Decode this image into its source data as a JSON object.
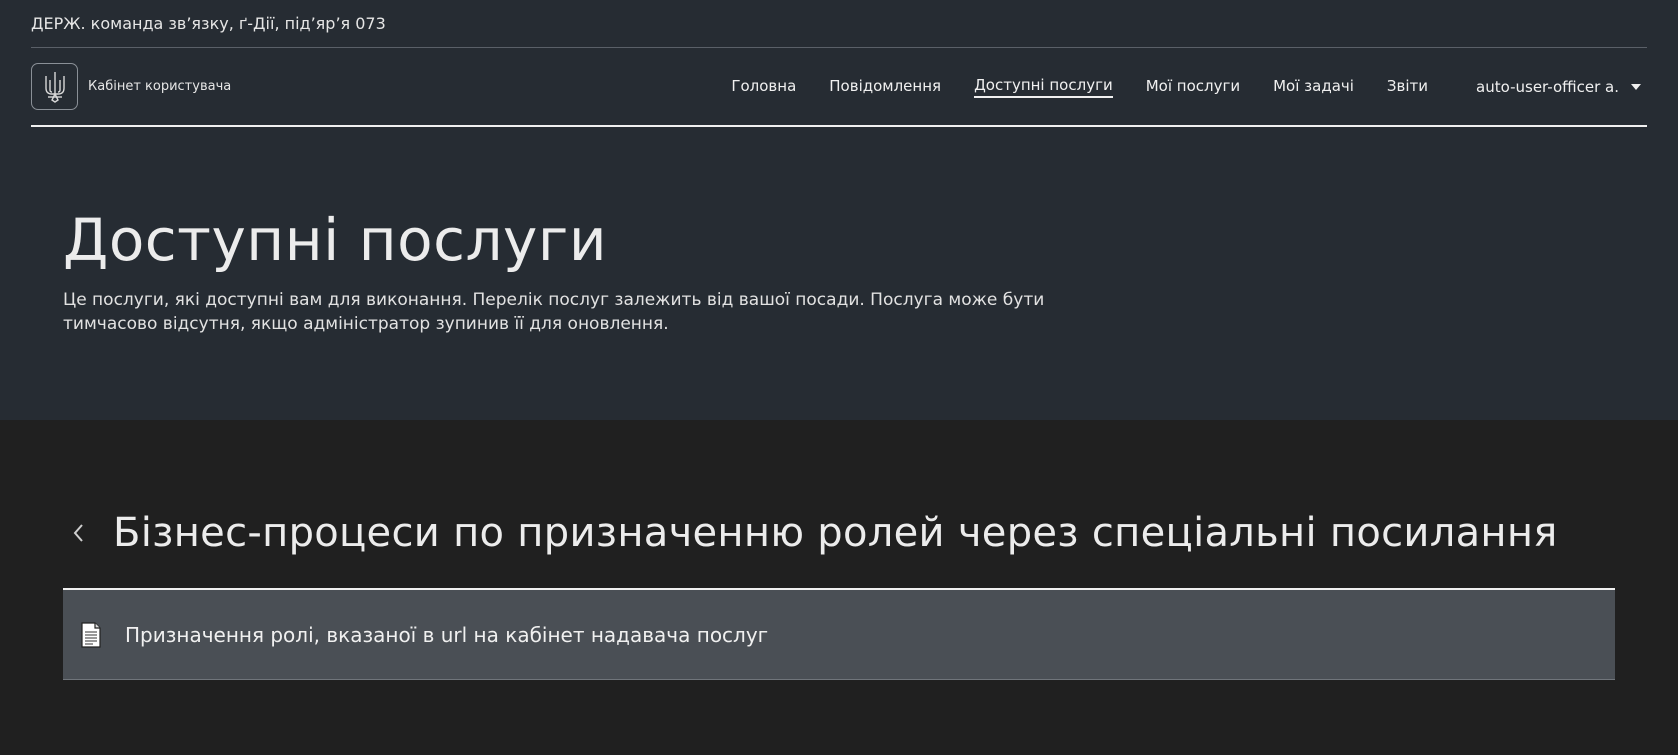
{
  "org": {
    "name": "ДЕРЖ. команда зв’язку, ґ-Дії, під’яр’я 073"
  },
  "header": {
    "cabinet_label": "Кабінет користувача",
    "logo_icon": "trident-icon",
    "nav": [
      {
        "label": "Головна",
        "active": false
      },
      {
        "label": "Повідомлення",
        "active": false
      },
      {
        "label": "Доступні послуги",
        "active": true
      },
      {
        "label": "Мої послуги",
        "active": false
      },
      {
        "label": "Мої задачі",
        "active": false
      },
      {
        "label": "Звіти",
        "active": false
      }
    ],
    "user": {
      "name": "auto-user-officer a."
    }
  },
  "hero": {
    "title": "Доступні послуги",
    "description": "Це послуги, які доступні вам для виконання. Перелік послуг залежить від вашої посади. Послуга може бути тимчасово відсутня, якщо адміністратор зупинив її для оновлення."
  },
  "section": {
    "title": "Бізнес-процеси по призначенню ролей через спеціальні посилання",
    "items": [
      {
        "label": "Призначення ролі, вказаної в url на кабінет надавача послуг",
        "icon": "document-icon"
      }
    ]
  },
  "colors": {
    "header_bg": "#262c33",
    "body_bg": "#202020",
    "item_bg": "#4a4f55",
    "text": "#f0f0f0"
  }
}
